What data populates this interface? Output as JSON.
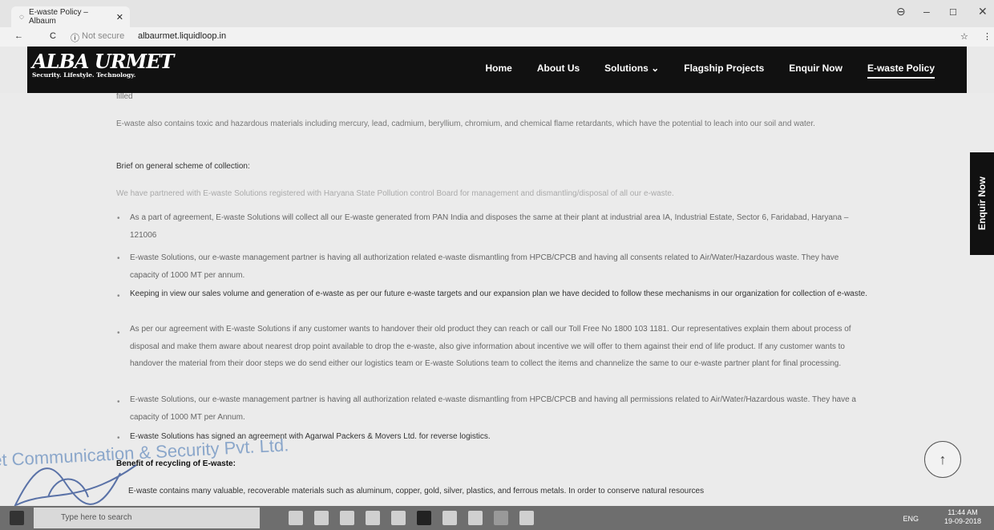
{
  "browser": {
    "tab_title": "E-waste Policy – Albaum",
    "not_secure": "Not secure",
    "url": "albaurmet.liquidloop.in"
  },
  "site": {
    "logo_text": "ALBA URMET",
    "logo_tagline": "Security. Lifestyle. Technology.",
    "nav": [
      "Home",
      "About Us",
      "Solutions",
      "Flagship Projects",
      "Enquir Now",
      "E-waste Policy"
    ],
    "side_button": "Enquir Now"
  },
  "content": {
    "top_fragment": "filled",
    "para1": "E-waste also contains toxic and hazardous materials including mercury, lead, cadmium, beryllium, chromium, and chemical flame retardants, which have the potential to leach into our soil and water.",
    "heading1": "Brief on general scheme of collection:",
    "para2": "We have partnered with E-waste Solutions registered with Haryana State Pollution control Board for management and dismantling/disposal of all our e-waste.",
    "bullets": [
      "As a part of agreement, E-waste Solutions will collect all our E-waste generated from PAN India and disposes the same at their plant at industrial area IA, Industrial Estate, Sector 6, Faridabad, Haryana – 121006",
      "E-waste Solutions, our e-waste management partner is having all authorization related e-waste dismantling from HPCB/CPCB and having all consents related to Air/Water/Hazardous waste. They have capacity of 1000 MT per annum.",
      "Keeping in view our sales volume and generation of e-waste as per our future e-waste targets and our expansion plan we have decided to follow these mechanisms in our organization for collection of e-waste.",
      "As per our agreement with E-waste Solutions if any customer wants to handover their old product they can reach or call our Toll Free No 1800 103 1181. Our representatives explain them about process of disposal and make them aware about nearest drop point available to drop the e-waste, also give information about incentive we will offer to them against their end of life product. If any customer wants to handover the material from their door steps we do send either our logistics team or E-waste Solutions team to collect the items and channelize the same to our e-waste partner plant for final processing.",
      "E-waste Solutions, our e-waste management partner is having all authorization related e-waste dismantling from HPCB/CPCB and having all permissions related to Air/Water/Hazardous waste. They have a capacity of 1000 MT per Annum.",
      "E-waste Solutions has signed an agreement with Agarwal Packers & Movers Ltd. for reverse logistics."
    ],
    "heading2": "Benefit of recycling of E-waste:",
    "para3": "E-waste contains many valuable, recoverable materials such as aluminum, copper, gold, silver, plastics, and ferrous metals. In order to conserve natural resources",
    "stamp_text": "et Communication & Security Pvt. Ltd."
  },
  "taskbar": {
    "search_placeholder": "Type here to search",
    "lang": "ENG",
    "time": "11:44 AM",
    "date": "19-09-2018"
  }
}
